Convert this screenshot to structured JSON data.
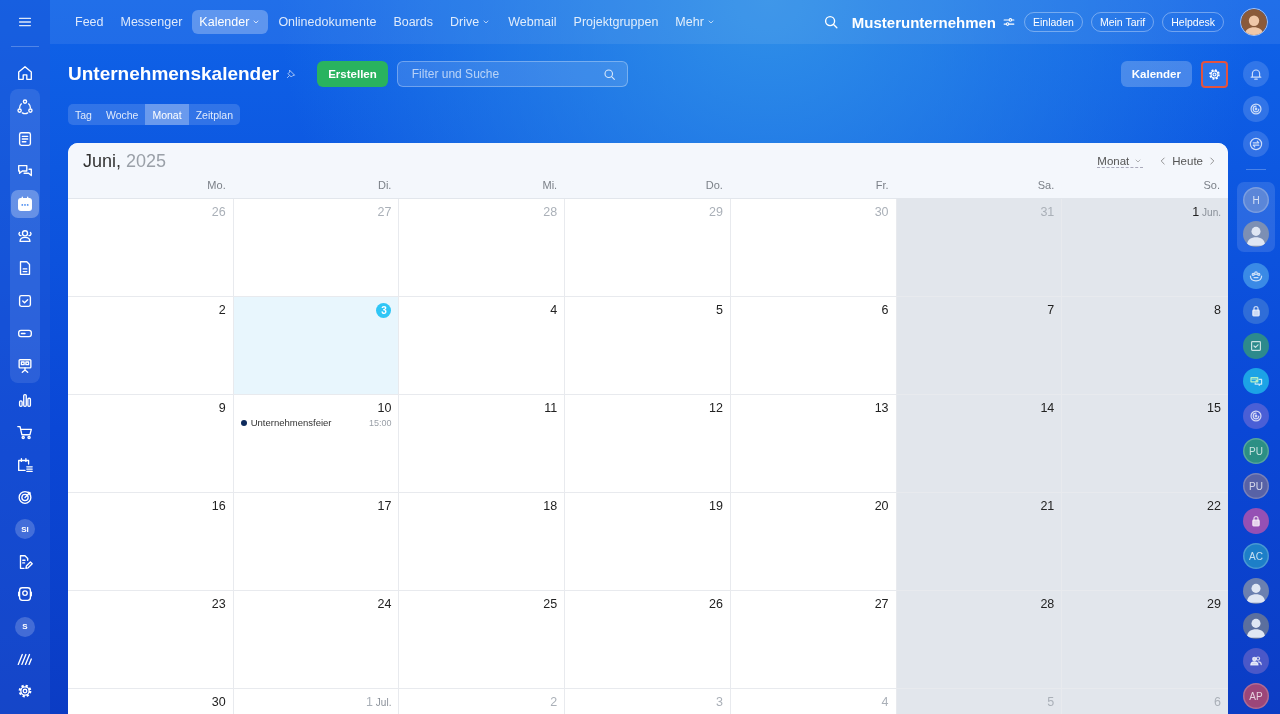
{
  "top_nav": {
    "items": [
      {
        "label": "Feed",
        "selected": false,
        "dropdown": false
      },
      {
        "label": "Messenger",
        "selected": false,
        "dropdown": false
      },
      {
        "label": "Kalender",
        "selected": true,
        "dropdown": true
      },
      {
        "label": "Onlinedokumente",
        "selected": false,
        "dropdown": false
      },
      {
        "label": "Boards",
        "selected": false,
        "dropdown": false
      },
      {
        "label": "Drive",
        "selected": false,
        "dropdown": true
      },
      {
        "label": "Webmail",
        "selected": false,
        "dropdown": false
      },
      {
        "label": "Projektgruppen",
        "selected": false,
        "dropdown": false
      },
      {
        "label": "Mehr",
        "selected": false,
        "dropdown": true
      }
    ],
    "company": "Musterunternehmen",
    "buttons": [
      "Einladen",
      "Mein Tarif",
      "Helpdesk"
    ]
  },
  "left_sidebar": {
    "top_items": [
      {
        "kind": "icon",
        "selected": false
      }
    ],
    "group_items": [
      {
        "kind": "icon",
        "selected": false
      },
      {
        "kind": "icon",
        "selected": false
      },
      {
        "kind": "icon",
        "selected": false
      },
      {
        "kind": "icon",
        "selected": true
      },
      {
        "kind": "icon",
        "selected": false
      },
      {
        "kind": "icon",
        "selected": false
      },
      {
        "kind": "icon",
        "selected": false
      },
      {
        "kind": "icon",
        "selected": false
      },
      {
        "kind": "icon",
        "selected": false
      }
    ],
    "items": [
      {
        "kind": "icon",
        "selected": false
      },
      {
        "kind": "icon",
        "selected": false
      },
      {
        "kind": "icon",
        "selected": false
      },
      {
        "kind": "icon",
        "selected": false
      },
      {
        "kind": "avatar",
        "text": "SI",
        "selected": false
      },
      {
        "kind": "icon",
        "selected": false
      },
      {
        "kind": "icon",
        "selected": false
      },
      {
        "kind": "avatar",
        "text": "S",
        "selected": false
      },
      {
        "kind": "icon",
        "selected": false
      },
      {
        "kind": "icon",
        "selected": false
      }
    ]
  },
  "header": {
    "title": "Unternehmenskalender",
    "create_button": "Erstellen",
    "search": {
      "placeholder": "Filter und Suche"
    },
    "calendar_button": "Kalender",
    "settings_button": {
      "highlighted": true
    },
    "view_tabs": [
      {
        "label": "Tag",
        "selected": false
      },
      {
        "label": "Woche",
        "selected": false
      },
      {
        "label": "Monat",
        "selected": true
      },
      {
        "label": "Zeitplan",
        "selected": false
      }
    ]
  },
  "calendar": {
    "month": "Juni,",
    "year": "2025",
    "view_select": "Monat",
    "today_button": "Heute",
    "columns": [
      {
        "label": "Mo.",
        "weekend": false
      },
      {
        "label": "Di.",
        "weekend": false
      },
      {
        "label": "Mi.",
        "weekend": false
      },
      {
        "label": "Do.",
        "weekend": false
      },
      {
        "label": "Fr.",
        "weekend": false
      },
      {
        "label": "Sa.",
        "weekend": true
      },
      {
        "label": "So.",
        "weekend": true
      }
    ],
    "weeks": [
      [
        {
          "day": "26",
          "muted": true
        },
        {
          "day": "27",
          "muted": true
        },
        {
          "day": "28",
          "muted": true
        },
        {
          "day": "29",
          "muted": true
        },
        {
          "day": "30",
          "muted": true
        },
        {
          "day": "31",
          "muted": true
        },
        {
          "day": "1",
          "suffix": "Jun.",
          "muted": false
        }
      ],
      [
        {
          "day": "2",
          "muted": false
        },
        {
          "day": "3",
          "muted": false,
          "today": true
        },
        {
          "day": "4",
          "muted": false
        },
        {
          "day": "5",
          "muted": false
        },
        {
          "day": "6",
          "muted": false
        },
        {
          "day": "7",
          "muted": false
        },
        {
          "day": "8",
          "muted": false
        }
      ],
      [
        {
          "day": "9",
          "muted": false
        },
        {
          "day": "10",
          "muted": false,
          "events": [
            {
              "title": "Unternehmensfeier",
              "time": "15:00",
              "color": "#0d2a5c"
            }
          ]
        },
        {
          "day": "11",
          "muted": false
        },
        {
          "day": "12",
          "muted": false
        },
        {
          "day": "13",
          "muted": false
        },
        {
          "day": "14",
          "muted": false
        },
        {
          "day": "15",
          "muted": false
        }
      ],
      [
        {
          "day": "16",
          "muted": false
        },
        {
          "day": "17",
          "muted": false
        },
        {
          "day": "18",
          "muted": false
        },
        {
          "day": "19",
          "muted": false
        },
        {
          "day": "20",
          "muted": false
        },
        {
          "day": "21",
          "muted": false
        },
        {
          "day": "22",
          "muted": false
        }
      ],
      [
        {
          "day": "23",
          "muted": false
        },
        {
          "day": "24",
          "muted": false
        },
        {
          "day": "25",
          "muted": false
        },
        {
          "day": "26",
          "muted": false
        },
        {
          "day": "27",
          "muted": false
        },
        {
          "day": "28",
          "muted": false
        },
        {
          "day": "29",
          "muted": false
        }
      ],
      [
        {
          "day": "30",
          "muted": false
        },
        {
          "day": "1",
          "suffix": "Jul.",
          "muted": true
        },
        {
          "day": "2",
          "muted": true
        },
        {
          "day": "3",
          "muted": true
        },
        {
          "day": "4",
          "muted": true
        },
        {
          "day": "5",
          "muted": true
        },
        {
          "day": "6",
          "muted": true
        }
      ]
    ]
  },
  "right_sidebar": {
    "top_items": [
      {
        "kind": "icon"
      },
      {
        "kind": "icon"
      },
      {
        "kind": "icon"
      }
    ],
    "group_items": [
      {
        "kind": "avatar",
        "text": "H",
        "color": "#5b86d8"
      },
      {
        "kind": "photo",
        "color": "#7c8fb4"
      }
    ],
    "items": [
      {
        "kind": "icon",
        "color": "#3a8ae6"
      },
      {
        "kind": "icon",
        "color": "#2f6dd8"
      },
      {
        "kind": "icon",
        "color": "#2d8a8c"
      },
      {
        "kind": "icon",
        "color": "#1ca3e6"
      },
      {
        "kind": "icon",
        "color": "#4a5fd6"
      },
      {
        "kind": "avatar",
        "text": "PU",
        "color": "#2c8f84"
      },
      {
        "kind": "avatar",
        "text": "PU",
        "color": "#5862a6"
      },
      {
        "kind": "icon",
        "color": "#9550b4"
      },
      {
        "kind": "avatar",
        "text": "AC",
        "color": "#1d7fc8"
      },
      {
        "kind": "photo",
        "color": "#6b80b0"
      },
      {
        "kind": "photo",
        "color": "#5b6f9e"
      },
      {
        "kind": "icon",
        "color": "#4a58c8"
      },
      {
        "kind": "avatar",
        "text": "AP",
        "color": "#9c4679"
      }
    ]
  }
}
